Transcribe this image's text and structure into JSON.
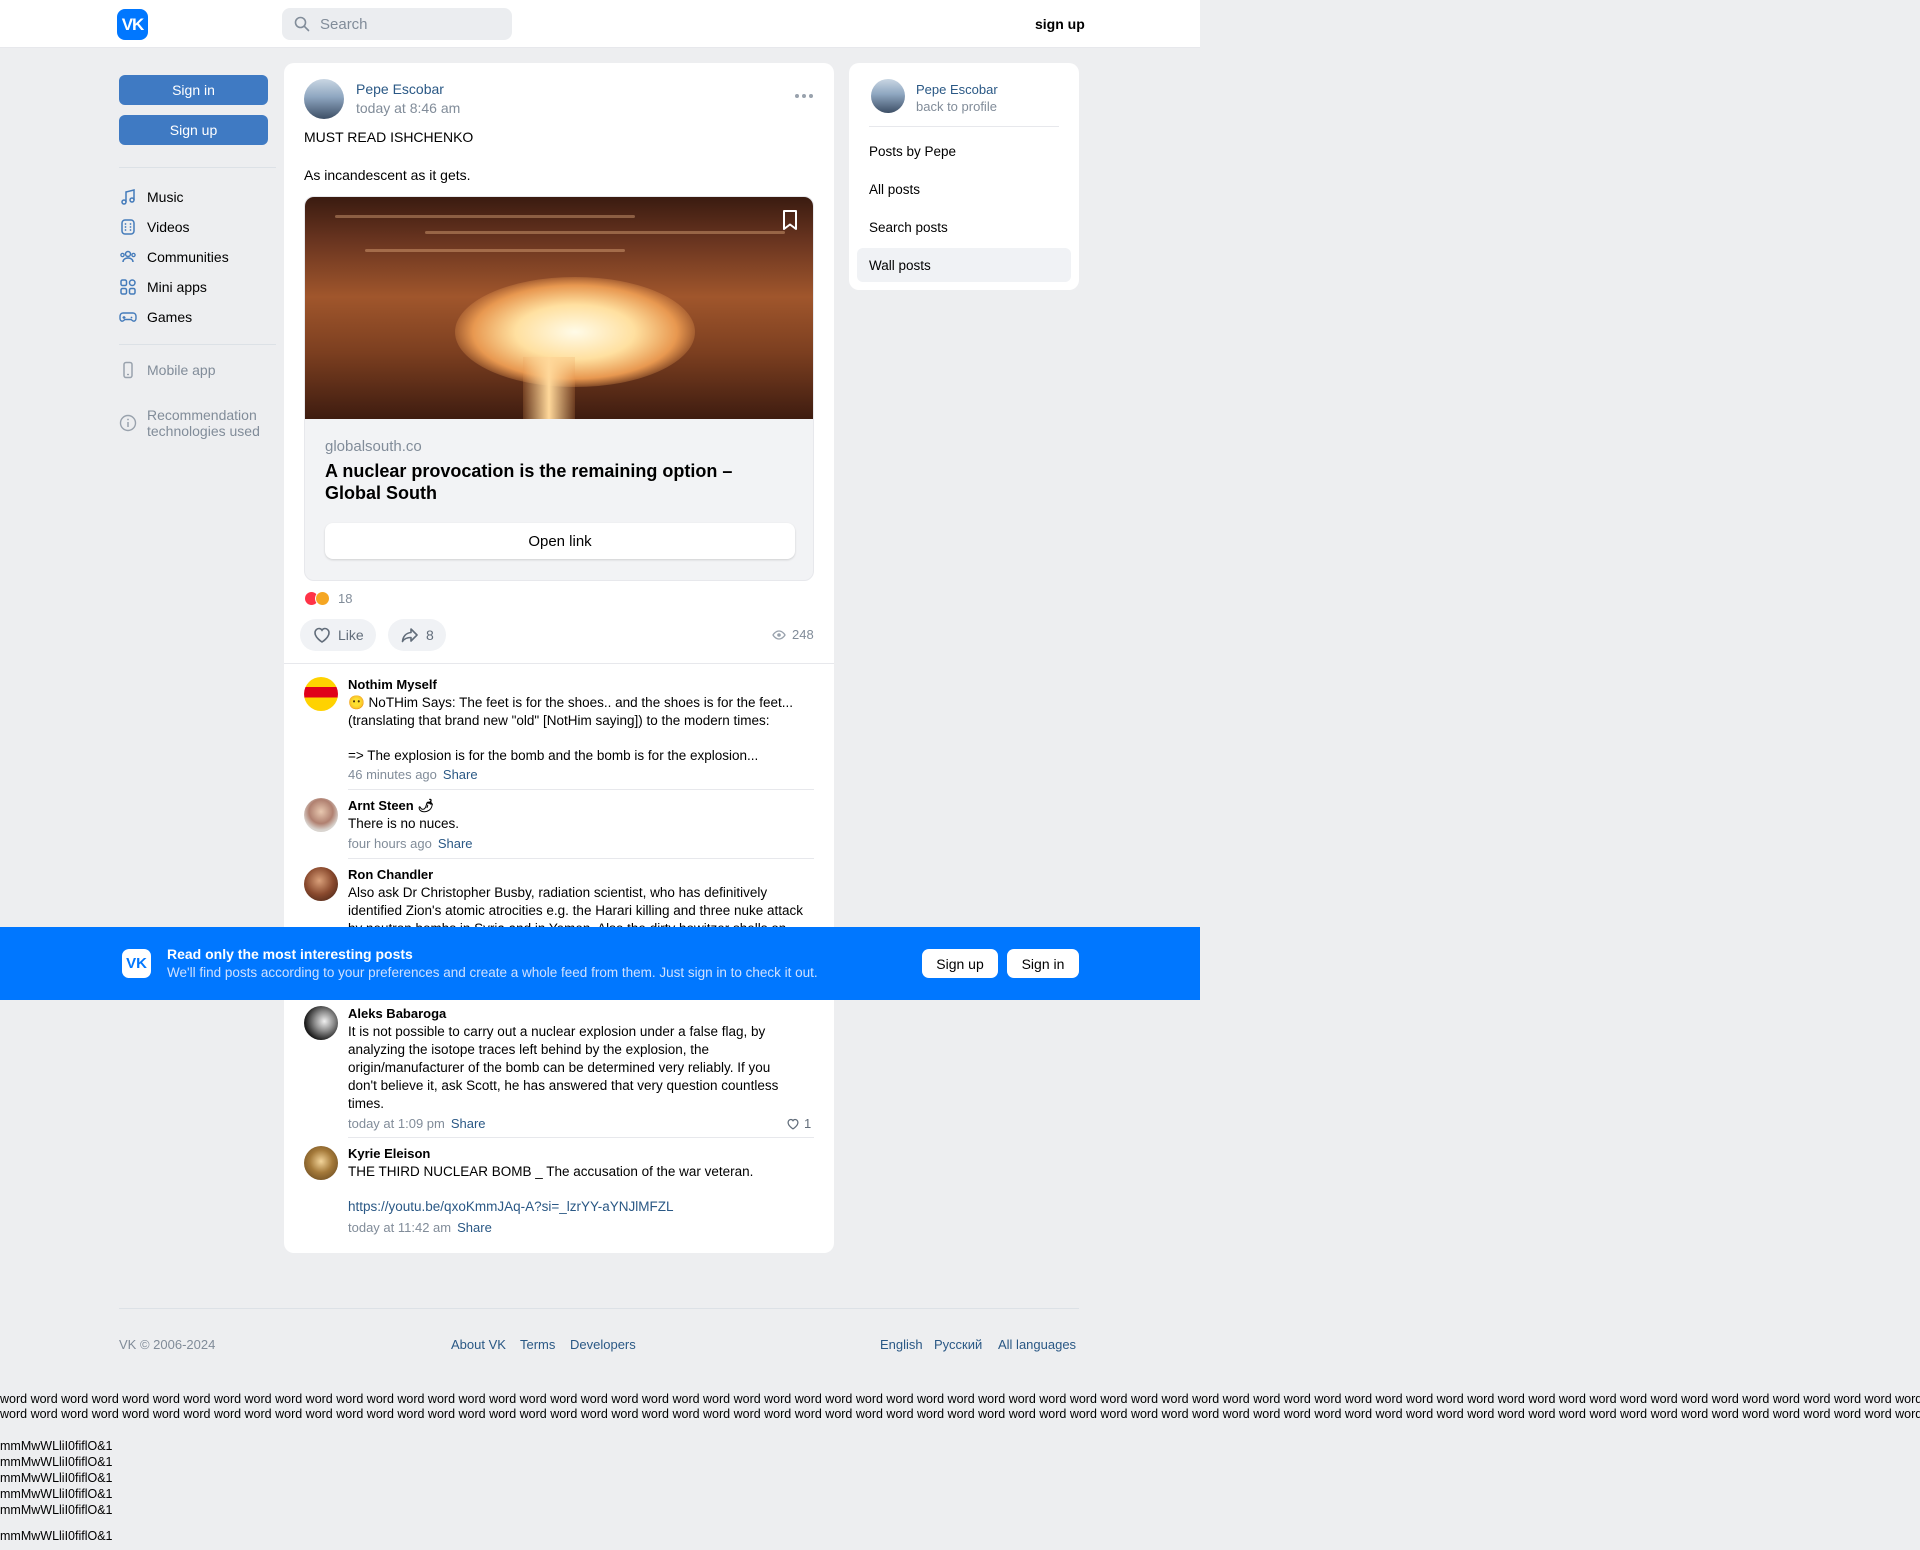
{
  "header": {
    "search_placeholder": "Search",
    "signup_label": "sign up"
  },
  "sidebar": {
    "signin_label": "Sign in",
    "signup_label": "Sign up",
    "items": [
      {
        "label": "Music",
        "icon": "music-note-icon"
      },
      {
        "label": "Videos",
        "icon": "video-film-icon"
      },
      {
        "label": "Communities",
        "icon": "users-icon"
      },
      {
        "label": "Mini apps",
        "icon": "grid-icon"
      },
      {
        "label": "Games",
        "icon": "gamepad-icon"
      }
    ],
    "mobile_app": "Mobile app",
    "recommendation_line1": "Recommendation",
    "recommendation_line2": "technologies used"
  },
  "post": {
    "author": "Pepe Escobar",
    "time": "today at 8:46 am",
    "text_line1": "MUST READ ISHCHENKO",
    "text_line2": "As incandescent as it gets.",
    "link": {
      "domain": "globalsouth.co",
      "title": "A nuclear provocation is the remaining option – Global South",
      "button": "Open link"
    },
    "reactions_count": "18",
    "like_label": "Like",
    "shares_count": "8",
    "views_count": "248"
  },
  "comments": [
    {
      "author": "Nothim Myself",
      "line1": "😶 NoTHim Says: The feet is for the shoes.. and the shoes is for the feet...",
      "line2": "(translating that brand new \"old\" [NotHim saying]) to the modern times:",
      "line3": "=> The explosion is for the bomb and the bomb is for the explosion...",
      "time": "46 minutes ago",
      "share": "Share"
    },
    {
      "author": "Arnt Steen 🌶",
      "text": "There is no nuces.",
      "time": "four hours ago",
      "share": "Share"
    },
    {
      "author": "Ron Chandler",
      "text": "Also ask Dr Christopher Busby, radiation scientist, who has definitively identified Zion's atomic atrocities e.g. the Harari killing and three nuke attack by neutron bombs in Syria and in Yemen. Also the dirty howitzer shells on"
    },
    {
      "author": "Aleks Babaroga",
      "text": "It is not possible to carry out a nuclear explosion under a false flag, by analyzing the isotope traces left behind by the explosion, the origin/manufacturer of the bomb can be determined very reliably. If you don't believe it, ask Scott, he has answered that very question countless times.",
      "time": "today at 1:09 pm",
      "share": "Share",
      "likes": "1"
    },
    {
      "author": "Kyrie Eleison",
      "text": "THE THIRD NUCLEAR BOMB _ The accusation of the war veteran.",
      "link": "https://youtu.be/qxoKmmJAq-A?si=_lzrYY-aYNJlMFZL",
      "time": "today at 11:42 am",
      "share": "Share"
    }
  ],
  "right_panel": {
    "name": "Pepe Escobar",
    "back": "back to profile",
    "items": [
      "Posts by Pepe",
      "All posts",
      "Search posts",
      "Wall posts"
    ]
  },
  "banner": {
    "title": "Read only the most interesting posts",
    "subtitle": "We'll find posts according to your preferences and create a whole feed from them. Just sign in to check it out.",
    "signup": "Sign up",
    "signin": "Sign in"
  },
  "footer": {
    "copyright": "VK © 2006-2024",
    "about": "About VK",
    "terms": "Terms",
    "developers": "Developers",
    "lang_en": "English",
    "lang_ru": "Русский",
    "lang_all": "All languages"
  },
  "filler": {
    "words": "word word word word word word word word word word word word word word word word word word word word word word word word word word word word word word word word word word word word word word word word word word word word word word word word word word word word word word word word word word word word word word word word word word word word word word word word word word word word word word word word word word word word word word word word word word word word word word word word word word word word word word word word",
    "glyphs": "mmMwWLliI0fiflO&1"
  },
  "colors": {
    "brand": "#0077ff",
    "link": "#2a5885",
    "button": "#3f7ac3",
    "background": "#edeef0"
  }
}
